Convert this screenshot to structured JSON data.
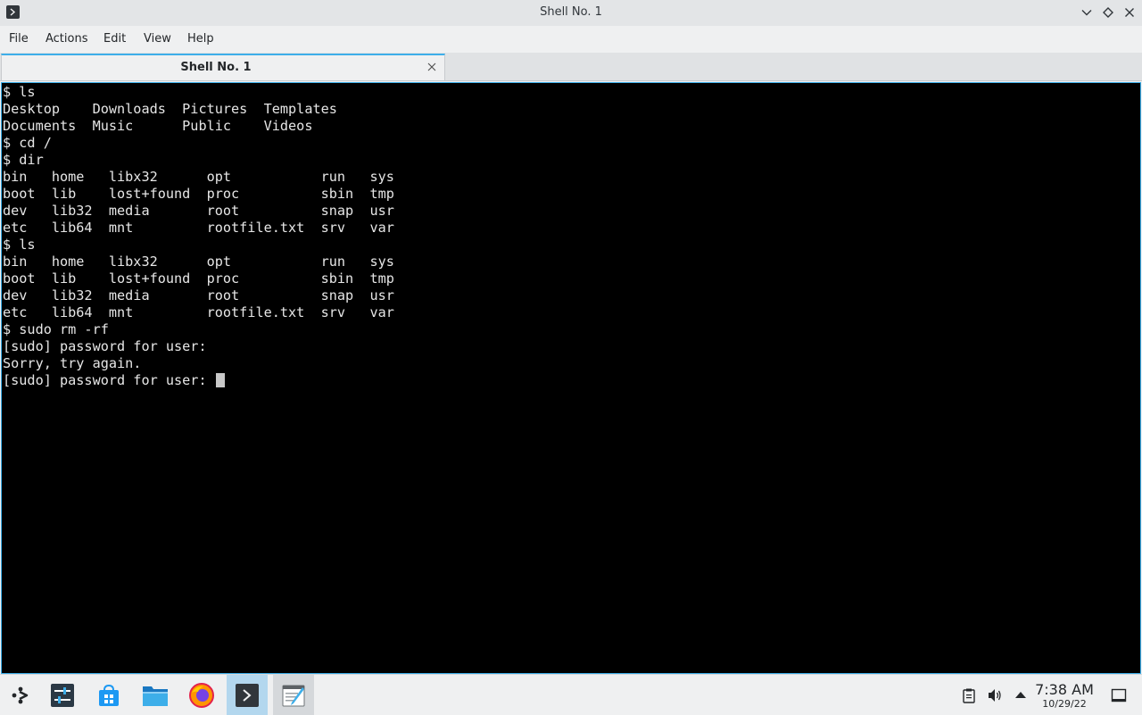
{
  "window": {
    "title": "Shell No. 1"
  },
  "menu": [
    "File",
    "Actions",
    "Edit",
    "View",
    "Help"
  ],
  "tab": {
    "label": "Shell No. 1"
  },
  "terminal": {
    "lines": [
      "$ ls",
      "Desktop    Downloads  Pictures  Templates",
      "Documents  Music      Public    Videos",
      "$ cd /",
      "$ dir",
      "bin   home   libx32      opt           run   sys",
      "boot  lib    lost+found  proc          sbin  tmp",
      "dev   lib32  media       root          snap  usr",
      "etc   lib64  mnt         rootfile.txt  srv   var",
      "$ ls",
      "bin   home   libx32      opt           run   sys",
      "boot  lib    lost+found  proc          sbin  tmp",
      "dev   lib32  media       root          snap  usr",
      "etc   lib64  mnt         rootfile.txt  srv   var",
      "$ sudo rm -rf",
      "[sudo] password for user:",
      "Sorry, try again.",
      "[sudo] password for user: "
    ]
  },
  "taskbar": {
    "items": [
      {
        "icon": "app-launcher-icon"
      },
      {
        "icon": "system-settings-icon"
      },
      {
        "icon": "discover-store-icon"
      },
      {
        "icon": "file-manager-icon"
      },
      {
        "icon": "firefox-icon"
      },
      {
        "icon": "terminal-icon"
      },
      {
        "icon": "text-editor-icon"
      }
    ]
  },
  "tray": {
    "icons": [
      "clipboard-icon",
      "volume-icon",
      "show-hidden-arrow-icon",
      "show-desktop-icon"
    ],
    "time": "7:38 AM",
    "date": "10/29/22"
  },
  "colors": {
    "accent": "#3daee9",
    "terminal_bg": "#000000",
    "terminal_fg": "#e6e6e6"
  }
}
